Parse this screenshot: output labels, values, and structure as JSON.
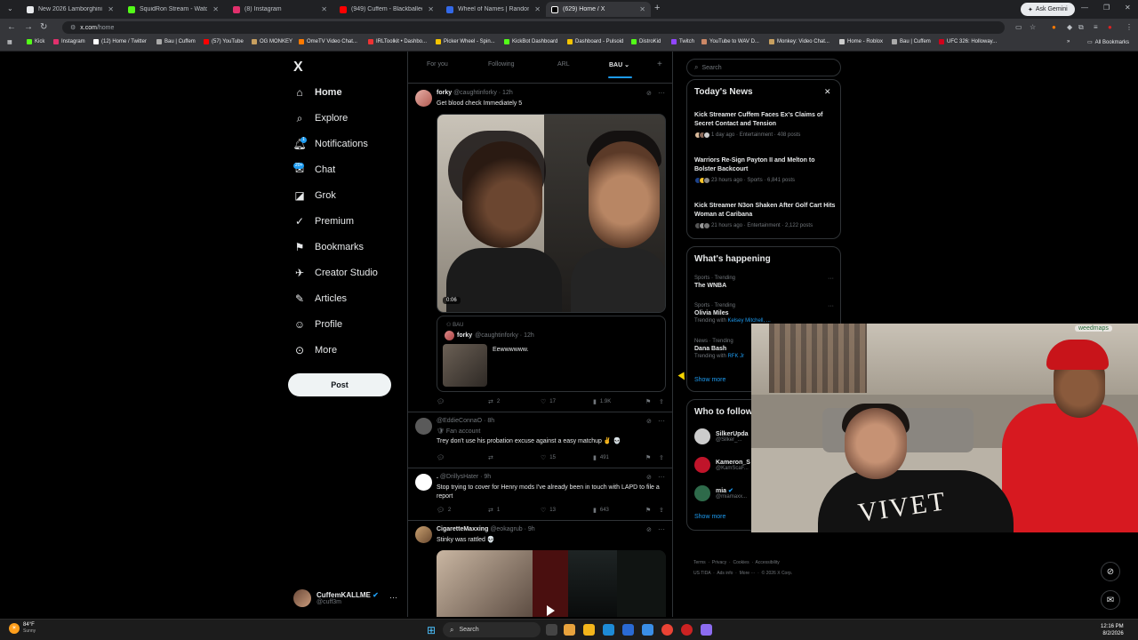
{
  "browser": {
    "tabs": [
      {
        "title": "New 2026 Lamborghini Urus SE",
        "color": "#e8eaed"
      },
      {
        "title": "SquidRon Stream - Watch Live",
        "color": "#53fc18"
      },
      {
        "title": "(8) Instagram",
        "color": "#e1306c"
      },
      {
        "title": "(949) Cuffem - Blackballed (Sh",
        "color": "#ff0000"
      },
      {
        "title": "Wheel of Names | Random nam",
        "color": "#3369e8"
      },
      {
        "title": "(629) Home / X",
        "color": "#ffffff"
      }
    ],
    "new_tab": "+",
    "ask_gemini": "Ask Gemini",
    "url_domain": "x.com",
    "url_path": "/home",
    "bookmarks": [
      {
        "label": "Kick",
        "color": "#53fc18"
      },
      {
        "label": "Instagram",
        "color": "#e1306c"
      },
      {
        "label": "(12) Home / Twitter",
        "color": "#ffffff"
      },
      {
        "label": "Bau | Cuffem",
        "color": "#aaaaaa"
      },
      {
        "label": "(57) YouTube",
        "color": "#ff0000"
      },
      {
        "label": "OG MONKEY",
        "color": "#c8a060"
      },
      {
        "label": "OmeTV Video Chat...",
        "color": "#ff7a00"
      },
      {
        "label": "IRLToolkit • Dashbo...",
        "color": "#e33"
      },
      {
        "label": "Picker Wheel - Spin...",
        "color": "#f5c400"
      },
      {
        "label": "KickBot Dashboard",
        "color": "#53fc18"
      },
      {
        "label": "Dashboard - Pulsoid",
        "color": "#f5c400"
      },
      {
        "label": "DistroKid",
        "color": "#53fc18"
      },
      {
        "label": "Twitch",
        "color": "#9146ff"
      },
      {
        "label": "YouTube to WAV D...",
        "color": "#c86"
      },
      {
        "label": "Monkey: Video Chat...",
        "color": "#c8a060"
      },
      {
        "label": "Home - Roblox",
        "color": "#cccccc"
      },
      {
        "label": "Bau | Cuffem",
        "color": "#aaaaaa"
      },
      {
        "label": "UFC 326: Holloway...",
        "color": "#d0021b"
      }
    ],
    "all_bookmarks": "All Bookmarks"
  },
  "nav": {
    "logo": "X",
    "items": [
      {
        "label": "Home",
        "icon": "home-icon",
        "glyph": "⌂"
      },
      {
        "label": "Explore",
        "icon": "search-icon",
        "glyph": "⌕"
      },
      {
        "label": "Notifications",
        "icon": "bell-icon",
        "glyph": "♫"
      },
      {
        "label": "Chat",
        "icon": "chat-icon",
        "glyph": "✉"
      },
      {
        "label": "Grok",
        "icon": "grok-icon",
        "glyph": "◪"
      },
      {
        "label": "Premium",
        "icon": "premium-icon",
        "glyph": "✓"
      },
      {
        "label": "Bookmarks",
        "icon": "bookmark-icon",
        "glyph": "⚑"
      },
      {
        "label": "Creator Studio",
        "icon": "creator-studio-icon",
        "glyph": "✈"
      },
      {
        "label": "Articles",
        "icon": "articles-icon",
        "glyph": "✎"
      },
      {
        "label": "Profile",
        "icon": "profile-icon",
        "glyph": "☺"
      },
      {
        "label": "More",
        "icon": "more-icon",
        "glyph": "⊙"
      }
    ],
    "notif_badge": "1",
    "chat_badge": "20+",
    "post_label": "Post",
    "account": {
      "name": "CuffemKALLME",
      "handle": "@cuff3m",
      "more": "···"
    }
  },
  "timeline": {
    "tabs": [
      "For you",
      "Following",
      "ARL",
      "BAU"
    ],
    "plus": "+",
    "posts": [
      {
        "name": "forky",
        "handle": "@caughtinforky",
        "time": "· 12h",
        "text": "Get blood check Immediately 5",
        "video_time": "0:06",
        "quote": {
          "label": "BAU",
          "name": "forky",
          "handle": "@caughtinforky · 12h",
          "text": "Eewwwwww."
        },
        "replies": "",
        "reposts": "2",
        "likes": "17",
        "views": "1.9K"
      },
      {
        "name": "",
        "handle": "@EddieConnaO",
        "time": "· 8h",
        "sub": "Fan account",
        "text": "Trey don't use his probation excuse against a easy matchup ✌ 💀",
        "replies": "",
        "reposts": "",
        "likes": "15",
        "views": "491"
      },
      {
        "name": ".",
        "handle": "@DrillysHater",
        "time": "· 9h",
        "text": "Stop trying to cover for Henry mods I've already been in touch with LAPD to file a report",
        "replies": "2",
        "reposts": "1",
        "likes": "13",
        "views": "643"
      },
      {
        "name": "CigaretteMaxxing",
        "handle": "@eokagrub",
        "time": "· 9h",
        "text": "Stinky was rattled 💀"
      }
    ]
  },
  "sidebar": {
    "search_placeholder": "Search",
    "news_title": "Today's News",
    "close": "✕",
    "news": [
      {
        "title": "Kick Streamer Cuffem Faces Ex's Claims of Secret Contact and Tension",
        "meta": "1 day ago · Entertainment · 408 posts"
      },
      {
        "title": "Warriors Re-Sign Payton II and Melton to Bolster Backcourt",
        "meta": "23 hours ago · Sports · 6,841 posts"
      },
      {
        "title": "Kick Streamer N3on Shaken After Golf Cart Hits Woman at Caribana",
        "meta": "21 hours ago · Entertainment · 2,122 posts"
      }
    ],
    "happening_title": "What's happening",
    "trends": [
      {
        "context": "Sports · Trending",
        "name": "The WNBA",
        "sub": "",
        "link": ""
      },
      {
        "context": "Sports · Trending",
        "name": "Olivia Miles",
        "sub": "Trending with",
        "link": "Kelsey Mitchell, ..."
      },
      {
        "context": "News · Trending",
        "name": "Dana Bash",
        "sub": "Trending with",
        "link": "RFK Jr"
      }
    ],
    "show_more": "Show more",
    "follow_title": "Who to follow",
    "follows": [
      {
        "name": "SilkerUpda",
        "handle": "@Silker_..."
      },
      {
        "name": "Kameron_S",
        "handle": "@KamScaF..."
      },
      {
        "name": "mia",
        "handle": "@miamaxx..."
      }
    ],
    "show_more2": "Show more",
    "footer1": [
      "Terms",
      "Privacy",
      "Cookies",
      "Accessibility"
    ],
    "footer2": [
      "US TIDA",
      "Ads info",
      "More ···",
      "© 2026 X Corp."
    ]
  },
  "cam": {
    "print": "VIVET",
    "watermark": "weedmaps"
  },
  "taskbar": {
    "weather_temp": "84°F",
    "weather_desc": "Sunny",
    "search_label": "Search",
    "time": "12:16 PM",
    "date": "8/2/2026"
  }
}
